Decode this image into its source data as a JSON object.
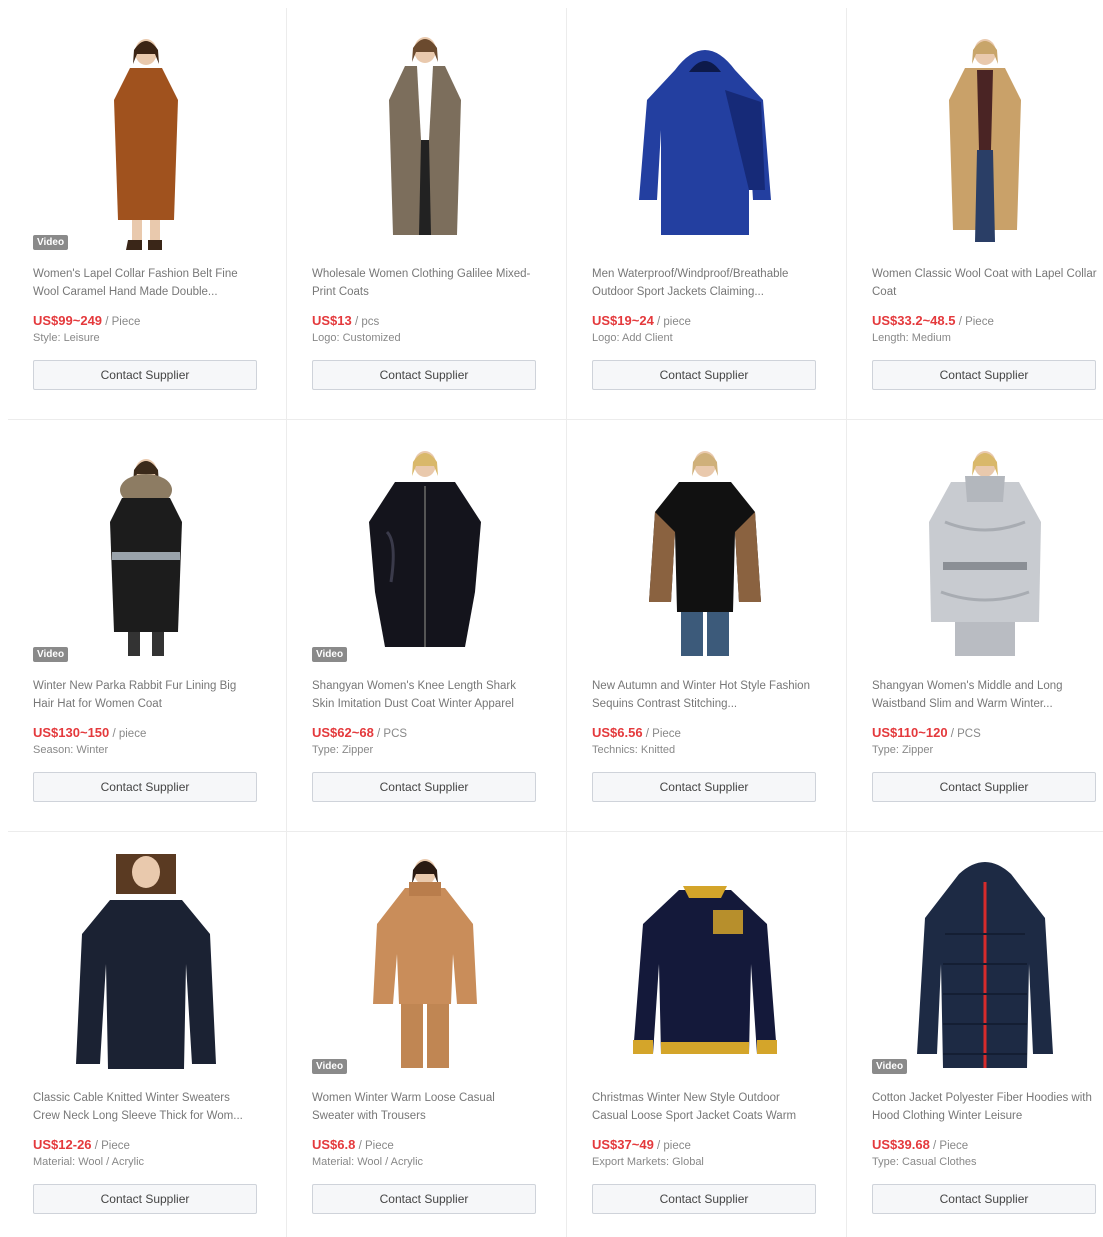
{
  "products": [
    {
      "title": "Women's Lapel Collar Fashion Belt Fine Wool Caramel Hand Made Double...",
      "price": "US$99~249",
      "unit": "/ Piece",
      "attr": "Style: Leisure",
      "video": "Video",
      "image": "woman-caramel-long-coat",
      "color": "#a0521e",
      "button": "Contact Supplier"
    },
    {
      "title": "Wholesale Women Clothing Galilee Mixed-Print Coats",
      "price": "US$13",
      "unit": "/ pcs",
      "attr": "Logo: Customized",
      "video": "",
      "image": "woman-tweed-coat",
      "color": "#7c6e5c",
      "button": "Contact Supplier"
    },
    {
      "title": "Men Waterproof/Windproof/Breathable Outdoor Sport Jackets Claiming...",
      "price": "US$19~24",
      "unit": "/ piece",
      "attr": "Logo: Add Client",
      "video": "",
      "image": "blue-hooded-jacket",
      "color": "#233fa0",
      "button": "Contact Supplier"
    },
    {
      "title": "Women Classic Wool Coat with Lapel Collar Coat",
      "price": "US$33.2~48.5",
      "unit": "/ Piece",
      "attr": "Length: Medium",
      "video": "",
      "image": "woman-camel-coat",
      "color": "#c9a169",
      "button": "Contact Supplier"
    },
    {
      "title": "Winter New Parka Rabbit Fur Lining Big Hair Hat for Women Coat",
      "price": "US$130~150",
      "unit": "/ piece",
      "attr": "Season: Winter",
      "video": "Video",
      "image": "woman-black-parka",
      "color": "#1c1c1c",
      "button": "Contact Supplier"
    },
    {
      "title": "Shangyan Women's Knee Length Shark Skin Imitation Dust Coat Winter Apparel",
      "price": "US$62~68",
      "unit": "/ PCS",
      "attr": "Type: Zipper",
      "video": "Video",
      "image": "woman-velvet-coat",
      "color": "#14141c",
      "button": "Contact Supplier"
    },
    {
      "title": "New Autumn and Winter Hot Style Fashion Sequins Contrast Stitching...",
      "price": "US$6.56",
      "unit": "/ Piece",
      "attr": "Technics: Knitted",
      "video": "",
      "image": "woman-sequin-sweater",
      "color": "#111111",
      "button": "Contact Supplier"
    },
    {
      "title": "Shangyan Women's Middle and Long Waistband Slim and Warm Winter...",
      "price": "US$110~120",
      "unit": "/ PCS",
      "attr": "Type: Zipper",
      "video": "",
      "image": "woman-silver-puffer",
      "color": "#c8cbd0",
      "button": "Contact Supplier"
    },
    {
      "title": "Classic Cable Knitted Winter Sweaters Crew Neck Long Sleeve Thick for Wom...",
      "price": "US$12-26",
      "unit": "/ Piece",
      "attr": "Material: Wool / Acrylic",
      "video": "",
      "image": "woman-navy-sweater",
      "color": "#1b2233",
      "button": "Contact Supplier"
    },
    {
      "title": "Women Winter Warm Loose Casual Sweater with Trousers",
      "price": "US$6.8",
      "unit": "/ Piece",
      "attr": "Material: Wool / Acrylic",
      "video": "Video",
      "image": "woman-tan-sweater-set",
      "color": "#c98d5a",
      "button": "Contact Supplier"
    },
    {
      "title": "Christmas Winter New Style Outdoor Casual Loose Sport Jacket Coats Warm",
      "price": "US$37~49",
      "unit": "/ piece",
      "attr": "Export Markets: Global",
      "video": "",
      "image": "navy-varsity-jacket",
      "color": "#14193a",
      "button": "Contact Supplier"
    },
    {
      "title": "Cotton Jacket Polyester Fiber Hoodies with Hood Clothing Winter Leisure",
      "price": "US$39.68",
      "unit": "/ Piece",
      "attr": "Type: Casual Clothes",
      "video": "Video",
      "image": "navy-puffer-jacket",
      "color": "#1d2a44",
      "button": "Contact Supplier"
    }
  ]
}
